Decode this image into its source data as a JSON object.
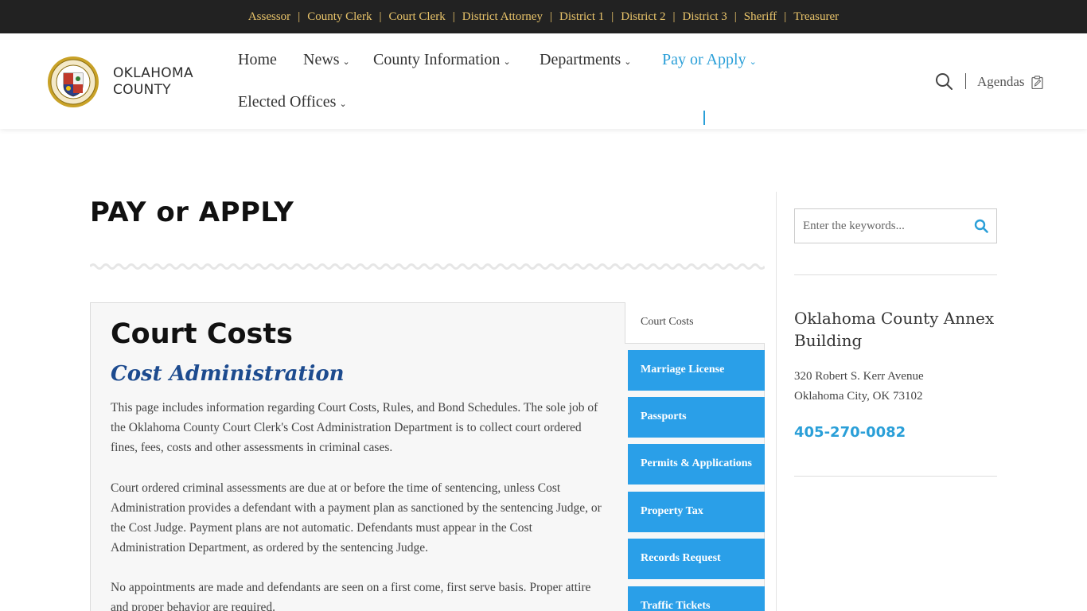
{
  "topbar": {
    "links": [
      "Assessor",
      "County Clerk",
      "Court Clerk",
      "District Attorney",
      "District 1",
      "District 2",
      "District 3",
      "Sheriff",
      "Treasurer"
    ],
    "separator": "|"
  },
  "header": {
    "logo_line1": "OKLAHOMA",
    "logo_line2": "COUNTY",
    "nav": [
      {
        "label": "Home"
      },
      {
        "label": "News"
      },
      {
        "label": "County Information"
      },
      {
        "label": "Departments"
      },
      {
        "label": "Pay or Apply"
      },
      {
        "label": "Elected Offices"
      }
    ],
    "chevron": "⌄",
    "agendas_label": "Agendas"
  },
  "main": {
    "page_title": "PAY or APPLY",
    "section_title": "Court Costs",
    "section_subtitle": "Cost Administration",
    "paragraphs": [
      "This page includes information regarding Court Costs, Rules, and Bond Schedules. The sole job of the Oklahoma County Court Clerk's Cost Administration Department is to collect court ordered fines, fees, costs and other assessments in criminal cases.",
      "Court ordered criminal assessments are due at or before the time of sentencing, unless Cost Administration provides a defendant with a payment plan as sanctioned by the sentencing Judge, or the Cost Judge. Payment plans are not automatic. Defendants must appear in the Cost Administration Department, as ordered by the sentencing Judge.",
      "No appointments are made and defendants are seen on a first come, first serve basis. Proper attire and proper behavior are required."
    ],
    "tabs": {
      "active": "Court Costs",
      "items": [
        "Marriage License",
        "Passports",
        "Permits & Applications",
        "Property Tax",
        "Records Request",
        "Traffic Tickets"
      ]
    }
  },
  "sidebar": {
    "search_placeholder": "Enter the keywords...",
    "annex_title": "Oklahoma County Annex Building",
    "address_line1": "320 Robert S. Kerr Avenue",
    "address_line2": "Oklahoma City, OK 73102",
    "phone": "405-270-0082"
  },
  "colors": {
    "accent": "#2a9fd8",
    "tab_blue": "#2a9fe8",
    "topbar_bg": "#222222",
    "topbar_link": "#e9c46a",
    "subtitle_navy": "#1d4b8f"
  }
}
